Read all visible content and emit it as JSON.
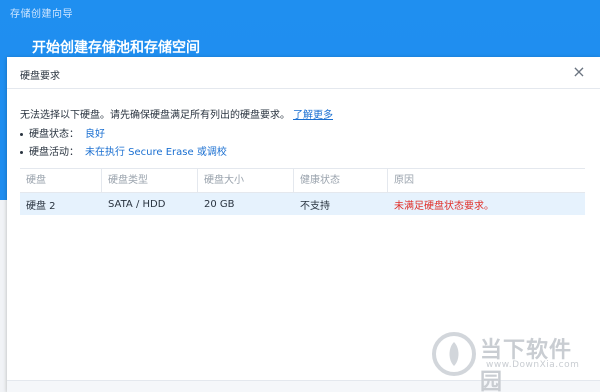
{
  "wizard": {
    "title": "存储创建向导",
    "heading": "开始创建存储池和存储空间"
  },
  "dialog": {
    "title": "硬盘要求",
    "close_icon": "close-icon",
    "intro": "无法选择以下硬盘。请先确保硬盘满足所有列出的硬盘要求。",
    "learn_more": "了解更多",
    "requirements": [
      {
        "label": "硬盘状态：",
        "value": "良好"
      },
      {
        "label": "硬盘活动：",
        "value": "未在执行 Secure Erase 或调校"
      }
    ],
    "table": {
      "headers": [
        "硬盘",
        "硬盘类型",
        "硬盘大小",
        "健康状态",
        "原因"
      ],
      "rows": [
        [
          "硬盘 2",
          "SATA / HDD",
          "20 GB",
          "不支持",
          "未满足硬盘状态要求。"
        ]
      ]
    }
  },
  "watermark": {
    "text": "当下软件园",
    "url": "www.DownXia.com"
  },
  "colors": {
    "accent": "#1e8cef",
    "link": "#1a6fd1",
    "error": "#e0302a",
    "row_highlight": "#e6f2fd"
  }
}
